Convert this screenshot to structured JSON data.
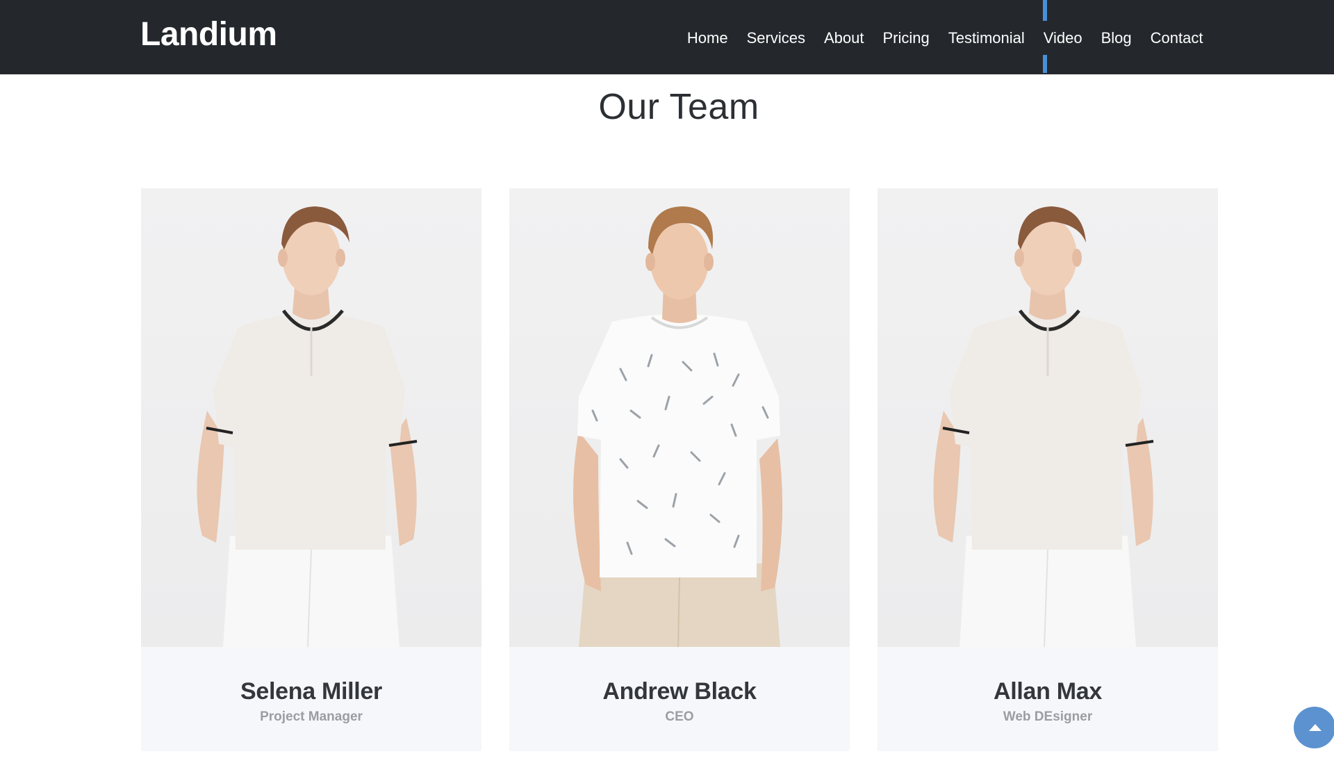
{
  "brand": {
    "name": "Landium"
  },
  "nav": {
    "items": [
      {
        "label": "Home"
      },
      {
        "label": "Services"
      },
      {
        "label": "About"
      },
      {
        "label": "Pricing"
      },
      {
        "label": "Testimonial"
      },
      {
        "label": "Video",
        "active": true
      },
      {
        "label": "Blog"
      },
      {
        "label": "Contact"
      }
    ]
  },
  "team": {
    "title": "Our Team",
    "members": [
      {
        "name": "Selena Miller",
        "role": "Project Manager"
      },
      {
        "name": "Andrew Black",
        "role": "CEO"
      },
      {
        "name": "Allan Max",
        "role": "Web DEsigner"
      }
    ]
  },
  "scroll_top": {
    "icon": "caret-up-icon"
  },
  "colors": {
    "navbar_bg": "#24282d",
    "accent": "#4a8fd9",
    "scroll_button": "#5b92cf",
    "card_bg": "#f5f7fa"
  }
}
